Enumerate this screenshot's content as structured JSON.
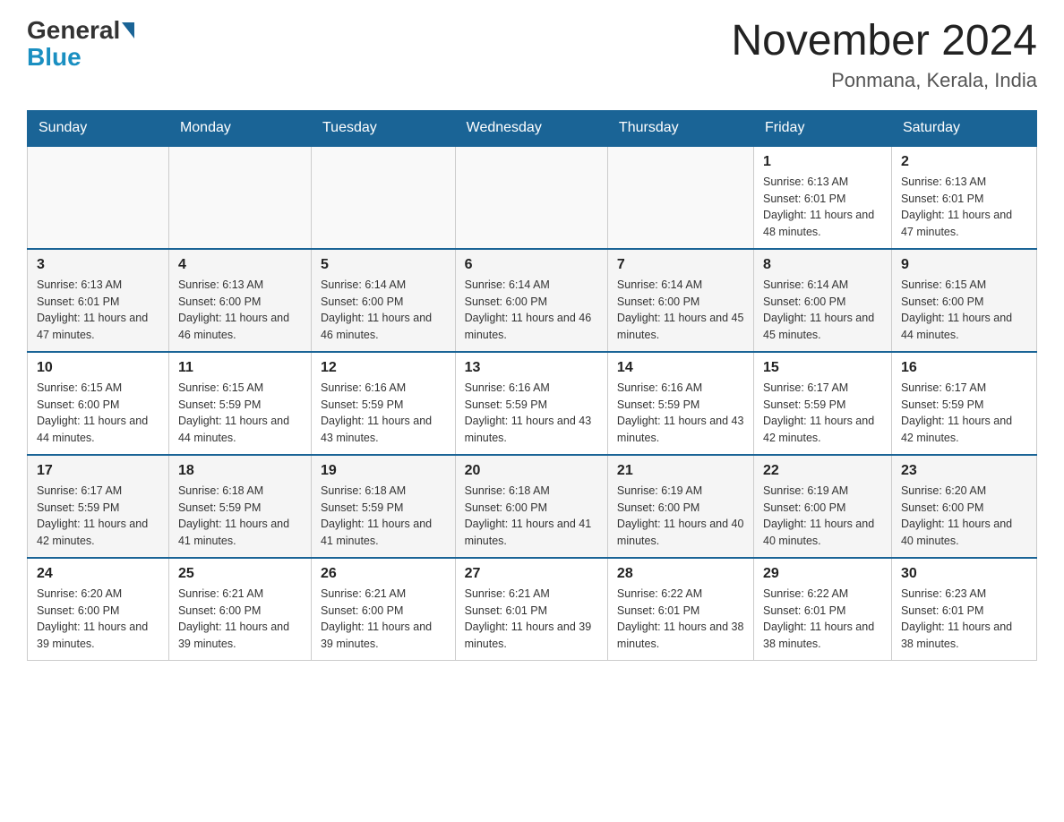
{
  "header": {
    "logo": {
      "general": "General",
      "blue": "Blue"
    },
    "title": "November 2024",
    "subtitle": "Ponmana, Kerala, India"
  },
  "weekdays": [
    "Sunday",
    "Monday",
    "Tuesday",
    "Wednesday",
    "Thursday",
    "Friday",
    "Saturday"
  ],
  "weeks": [
    [
      {
        "day": "",
        "info": ""
      },
      {
        "day": "",
        "info": ""
      },
      {
        "day": "",
        "info": ""
      },
      {
        "day": "",
        "info": ""
      },
      {
        "day": "",
        "info": ""
      },
      {
        "day": "1",
        "info": "Sunrise: 6:13 AM\nSunset: 6:01 PM\nDaylight: 11 hours and 48 minutes."
      },
      {
        "day": "2",
        "info": "Sunrise: 6:13 AM\nSunset: 6:01 PM\nDaylight: 11 hours and 47 minutes."
      }
    ],
    [
      {
        "day": "3",
        "info": "Sunrise: 6:13 AM\nSunset: 6:01 PM\nDaylight: 11 hours and 47 minutes."
      },
      {
        "day": "4",
        "info": "Sunrise: 6:13 AM\nSunset: 6:00 PM\nDaylight: 11 hours and 46 minutes."
      },
      {
        "day": "5",
        "info": "Sunrise: 6:14 AM\nSunset: 6:00 PM\nDaylight: 11 hours and 46 minutes."
      },
      {
        "day": "6",
        "info": "Sunrise: 6:14 AM\nSunset: 6:00 PM\nDaylight: 11 hours and 46 minutes."
      },
      {
        "day": "7",
        "info": "Sunrise: 6:14 AM\nSunset: 6:00 PM\nDaylight: 11 hours and 45 minutes."
      },
      {
        "day": "8",
        "info": "Sunrise: 6:14 AM\nSunset: 6:00 PM\nDaylight: 11 hours and 45 minutes."
      },
      {
        "day": "9",
        "info": "Sunrise: 6:15 AM\nSunset: 6:00 PM\nDaylight: 11 hours and 44 minutes."
      }
    ],
    [
      {
        "day": "10",
        "info": "Sunrise: 6:15 AM\nSunset: 6:00 PM\nDaylight: 11 hours and 44 minutes."
      },
      {
        "day": "11",
        "info": "Sunrise: 6:15 AM\nSunset: 5:59 PM\nDaylight: 11 hours and 44 minutes."
      },
      {
        "day": "12",
        "info": "Sunrise: 6:16 AM\nSunset: 5:59 PM\nDaylight: 11 hours and 43 minutes."
      },
      {
        "day": "13",
        "info": "Sunrise: 6:16 AM\nSunset: 5:59 PM\nDaylight: 11 hours and 43 minutes."
      },
      {
        "day": "14",
        "info": "Sunrise: 6:16 AM\nSunset: 5:59 PM\nDaylight: 11 hours and 43 minutes."
      },
      {
        "day": "15",
        "info": "Sunrise: 6:17 AM\nSunset: 5:59 PM\nDaylight: 11 hours and 42 minutes."
      },
      {
        "day": "16",
        "info": "Sunrise: 6:17 AM\nSunset: 5:59 PM\nDaylight: 11 hours and 42 minutes."
      }
    ],
    [
      {
        "day": "17",
        "info": "Sunrise: 6:17 AM\nSunset: 5:59 PM\nDaylight: 11 hours and 42 minutes."
      },
      {
        "day": "18",
        "info": "Sunrise: 6:18 AM\nSunset: 5:59 PM\nDaylight: 11 hours and 41 minutes."
      },
      {
        "day": "19",
        "info": "Sunrise: 6:18 AM\nSunset: 5:59 PM\nDaylight: 11 hours and 41 minutes."
      },
      {
        "day": "20",
        "info": "Sunrise: 6:18 AM\nSunset: 6:00 PM\nDaylight: 11 hours and 41 minutes."
      },
      {
        "day": "21",
        "info": "Sunrise: 6:19 AM\nSunset: 6:00 PM\nDaylight: 11 hours and 40 minutes."
      },
      {
        "day": "22",
        "info": "Sunrise: 6:19 AM\nSunset: 6:00 PM\nDaylight: 11 hours and 40 minutes."
      },
      {
        "day": "23",
        "info": "Sunrise: 6:20 AM\nSunset: 6:00 PM\nDaylight: 11 hours and 40 minutes."
      }
    ],
    [
      {
        "day": "24",
        "info": "Sunrise: 6:20 AM\nSunset: 6:00 PM\nDaylight: 11 hours and 39 minutes."
      },
      {
        "day": "25",
        "info": "Sunrise: 6:21 AM\nSunset: 6:00 PM\nDaylight: 11 hours and 39 minutes."
      },
      {
        "day": "26",
        "info": "Sunrise: 6:21 AM\nSunset: 6:00 PM\nDaylight: 11 hours and 39 minutes."
      },
      {
        "day": "27",
        "info": "Sunrise: 6:21 AM\nSunset: 6:01 PM\nDaylight: 11 hours and 39 minutes."
      },
      {
        "day": "28",
        "info": "Sunrise: 6:22 AM\nSunset: 6:01 PM\nDaylight: 11 hours and 38 minutes."
      },
      {
        "day": "29",
        "info": "Sunrise: 6:22 AM\nSunset: 6:01 PM\nDaylight: 11 hours and 38 minutes."
      },
      {
        "day": "30",
        "info": "Sunrise: 6:23 AM\nSunset: 6:01 PM\nDaylight: 11 hours and 38 minutes."
      }
    ]
  ]
}
